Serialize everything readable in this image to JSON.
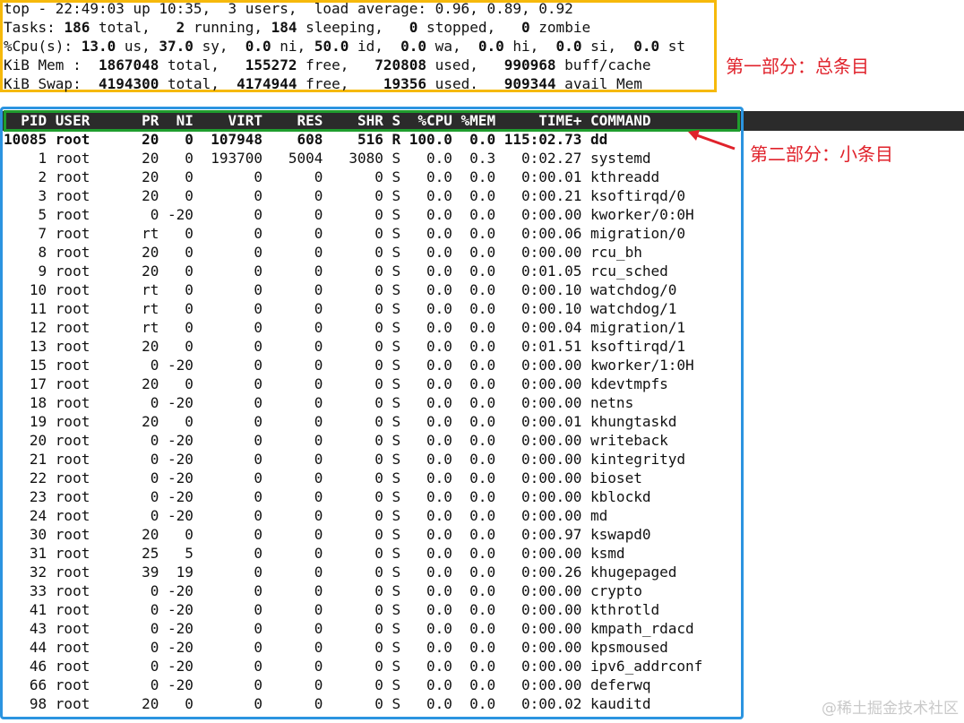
{
  "summary": {
    "lines": [
      [
        {
          "t": "top - 22:49:03 up 10:35,  3 users,  load average: 0.96, 0.89, 0.92",
          "b": false
        }
      ],
      [
        {
          "t": "Tasks: ",
          "b": false
        },
        {
          "t": "186",
          "b": true
        },
        {
          "t": " total,   ",
          "b": false
        },
        {
          "t": "2",
          "b": true
        },
        {
          "t": " running, ",
          "b": false
        },
        {
          "t": "184",
          "b": true
        },
        {
          "t": " sleeping,   ",
          "b": false
        },
        {
          "t": "0",
          "b": true
        },
        {
          "t": " stopped,   ",
          "b": false
        },
        {
          "t": "0",
          "b": true
        },
        {
          "t": " zombie",
          "b": false
        }
      ],
      [
        {
          "t": "%Cpu(s): ",
          "b": false
        },
        {
          "t": "13.0",
          "b": true
        },
        {
          "t": " us, ",
          "b": false
        },
        {
          "t": "37.0",
          "b": true
        },
        {
          "t": " sy,  ",
          "b": false
        },
        {
          "t": "0.0",
          "b": true
        },
        {
          "t": " ni, ",
          "b": false
        },
        {
          "t": "50.0",
          "b": true
        },
        {
          "t": " id,  ",
          "b": false
        },
        {
          "t": "0.0",
          "b": true
        },
        {
          "t": " wa,  ",
          "b": false
        },
        {
          "t": "0.0",
          "b": true
        },
        {
          "t": " hi,  ",
          "b": false
        },
        {
          "t": "0.0",
          "b": true
        },
        {
          "t": " si,  ",
          "b": false
        },
        {
          "t": "0.0",
          "b": true
        },
        {
          "t": " st",
          "b": false
        }
      ],
      [
        {
          "t": "KiB Mem :  ",
          "b": false
        },
        {
          "t": "1867048",
          "b": true
        },
        {
          "t": " total,   ",
          "b": false
        },
        {
          "t": "155272",
          "b": true
        },
        {
          "t": " free,   ",
          "b": false
        },
        {
          "t": "720808",
          "b": true
        },
        {
          "t": " used,   ",
          "b": false
        },
        {
          "t": "990968",
          "b": true
        },
        {
          "t": " buff/cache",
          "b": false
        }
      ],
      [
        {
          "t": "KiB Swap:  ",
          "b": false
        },
        {
          "t": "4194300",
          "b": true
        },
        {
          "t": " total,  ",
          "b": false
        },
        {
          "t": "4174944",
          "b": true
        },
        {
          "t": " free,    ",
          "b": false
        },
        {
          "t": "19356",
          "b": true
        },
        {
          "t": " used.   ",
          "b": false
        },
        {
          "t": "909344",
          "b": true
        },
        {
          "t": " avail Mem",
          "b": false
        }
      ]
    ]
  },
  "process_header": "  PID USER      PR  NI    VIRT    RES    SHR S  %CPU %MEM     TIME+ COMMAND",
  "process_rows": [
    {
      "text": "10085 root      20   0  107948    608    516 R 100.0  0.0 115:02.73 dd",
      "bold": true
    },
    {
      "text": "    1 root      20   0  193700   5004   3080 S   0.0  0.3   0:02.27 systemd",
      "bold": false
    },
    {
      "text": "    2 root      20   0       0      0      0 S   0.0  0.0   0:00.01 kthreadd",
      "bold": false
    },
    {
      "text": "    3 root      20   0       0      0      0 S   0.0  0.0   0:00.21 ksoftirqd/0",
      "bold": false
    },
    {
      "text": "    5 root       0 -20       0      0      0 S   0.0  0.0   0:00.00 kworker/0:0H",
      "bold": false
    },
    {
      "text": "    7 root      rt   0       0      0      0 S   0.0  0.0   0:00.06 migration/0",
      "bold": false
    },
    {
      "text": "    8 root      20   0       0      0      0 S   0.0  0.0   0:00.00 rcu_bh",
      "bold": false
    },
    {
      "text": "    9 root      20   0       0      0      0 S   0.0  0.0   0:01.05 rcu_sched",
      "bold": false
    },
    {
      "text": "   10 root      rt   0       0      0      0 S   0.0  0.0   0:00.10 watchdog/0",
      "bold": false
    },
    {
      "text": "   11 root      rt   0       0      0      0 S   0.0  0.0   0:00.10 watchdog/1",
      "bold": false
    },
    {
      "text": "   12 root      rt   0       0      0      0 S   0.0  0.0   0:00.04 migration/1",
      "bold": false
    },
    {
      "text": "   13 root      20   0       0      0      0 S   0.0  0.0   0:01.51 ksoftirqd/1",
      "bold": false
    },
    {
      "text": "   15 root       0 -20       0      0      0 S   0.0  0.0   0:00.00 kworker/1:0H",
      "bold": false
    },
    {
      "text": "   17 root      20   0       0      0      0 S   0.0  0.0   0:00.00 kdevtmpfs",
      "bold": false
    },
    {
      "text": "   18 root       0 -20       0      0      0 S   0.0  0.0   0:00.00 netns",
      "bold": false
    },
    {
      "text": "   19 root      20   0       0      0      0 S   0.0  0.0   0:00.01 khungtaskd",
      "bold": false
    },
    {
      "text": "   20 root       0 -20       0      0      0 S   0.0  0.0   0:00.00 writeback",
      "bold": false
    },
    {
      "text": "   21 root       0 -20       0      0      0 S   0.0  0.0   0:00.00 kintegrityd",
      "bold": false
    },
    {
      "text": "   22 root       0 -20       0      0      0 S   0.0  0.0   0:00.00 bioset",
      "bold": false
    },
    {
      "text": "   23 root       0 -20       0      0      0 S   0.0  0.0   0:00.00 kblockd",
      "bold": false
    },
    {
      "text": "   24 root       0 -20       0      0      0 S   0.0  0.0   0:00.00 md",
      "bold": false
    },
    {
      "text": "   30 root      20   0       0      0      0 S   0.0  0.0   0:00.97 kswapd0",
      "bold": false
    },
    {
      "text": "   31 root      25   5       0      0      0 S   0.0  0.0   0:00.00 ksmd",
      "bold": false
    },
    {
      "text": "   32 root      39  19       0      0      0 S   0.0  0.0   0:00.26 khugepaged",
      "bold": false
    },
    {
      "text": "   33 root       0 -20       0      0      0 S   0.0  0.0   0:00.00 crypto",
      "bold": false
    },
    {
      "text": "   41 root       0 -20       0      0      0 S   0.0  0.0   0:00.00 kthrotld",
      "bold": false
    },
    {
      "text": "   43 root       0 -20       0      0      0 S   0.0  0.0   0:00.00 kmpath_rdacd",
      "bold": false
    },
    {
      "text": "   44 root       0 -20       0      0      0 S   0.0  0.0   0:00.00 kpsmoused",
      "bold": false
    },
    {
      "text": "   46 root       0 -20       0      0      0 S   0.0  0.0   0:00.00 ipv6_addrconf",
      "bold": false
    },
    {
      "text": "   66 root       0 -20       0      0      0 S   0.0  0.0   0:00.00 deferwq",
      "bold": false
    },
    {
      "text": "   98 root      20   0       0      0      0 S   0.0  0.0   0:00.02 kauditd",
      "bold": false
    }
  ],
  "annotations": {
    "part1": "第一部分：总条目",
    "part2": "第二部分：小条目"
  },
  "watermark": "@稀土掘金技术社区",
  "colors": {
    "summary_box": "#f6b90b",
    "header_box": "#1f9d2e",
    "process_box": "#2b94e0",
    "annotation": "#e0222b"
  }
}
